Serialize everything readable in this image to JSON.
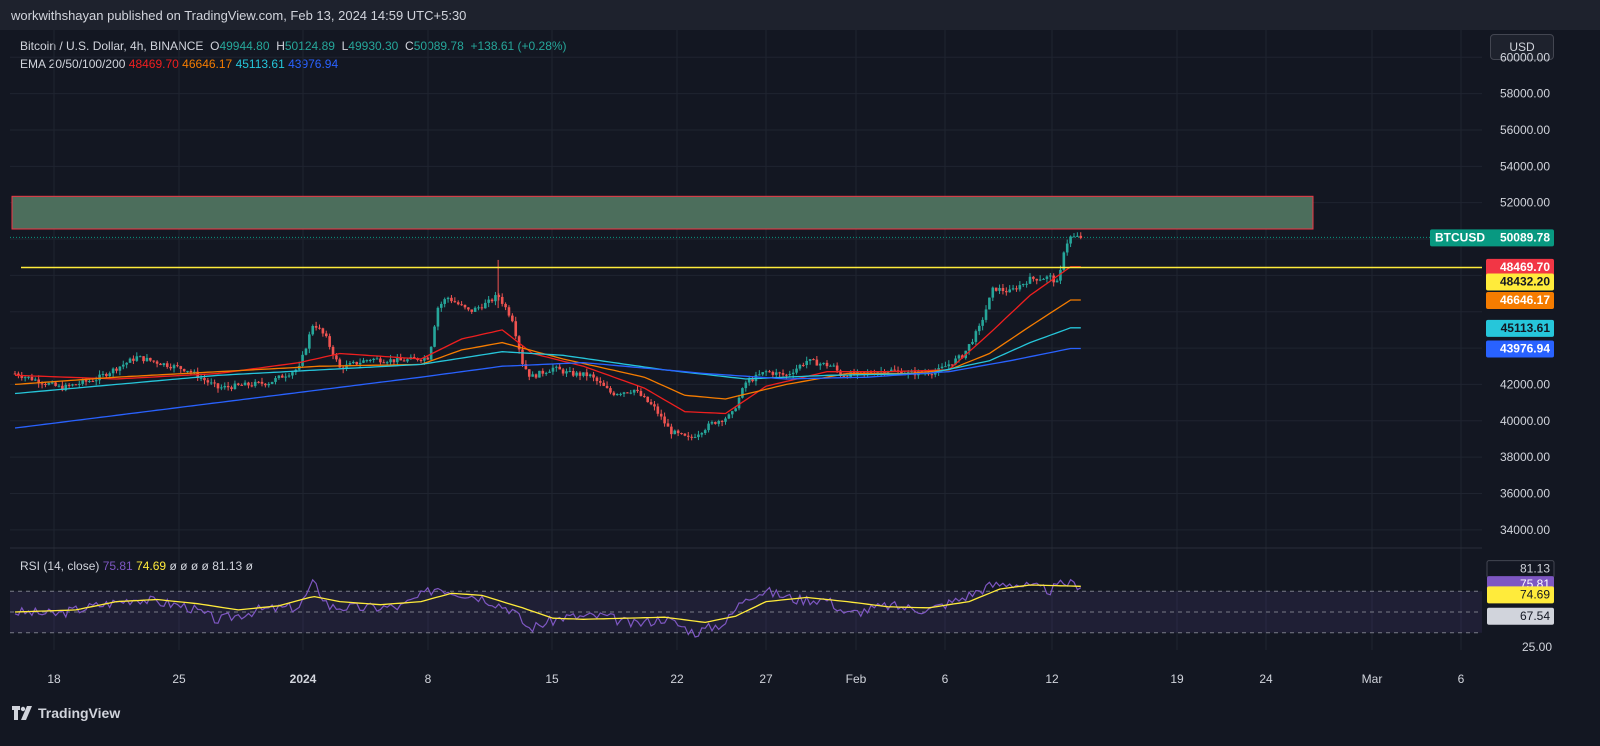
{
  "header": {
    "publisher": "workwithshayan published on TradingView.com, Feb 13, 2024 14:59 UTC+5:30"
  },
  "currency_button": "USD",
  "legend": {
    "symbol": "Bitcoin / U.S. Dollar, 4h, BINANCE",
    "o_label": "O",
    "o_value": "49944.80",
    "h_label": "H",
    "h_value": "50124.89",
    "l_label": "L",
    "l_value": "49930.30",
    "c_label": "C",
    "c_value": "50089.78",
    "change": "+138.61 (+0.28%)",
    "ema_title": "EMA 20/50/100/200",
    "ema20": "48469.70",
    "ema50": "46646.17",
    "ema100": "45113.61",
    "ema200": "43976.94"
  },
  "rsi_legend": {
    "title": "RSI (14, close)",
    "rsi": "75.81",
    "ma": "74.69",
    "empties": [
      "ø",
      "ø",
      "ø",
      "ø"
    ],
    "upper": "81.13",
    "last": "ø"
  },
  "brand": "TradingView",
  "colors": {
    "up": "#26a69a",
    "down": "#ef5350",
    "ema20": "#ef1f1f",
    "ema50": "#f57c00",
    "ema100": "#26c6da",
    "ema200": "#2962ff",
    "level": "#ffeb3b",
    "zone_fill": "#4c6e5c",
    "zone_border": "#f23645",
    "rsi_line": "#7e57c2",
    "rsi_ma": "#ffeb3b"
  },
  "chart_data": {
    "type": "candlestick",
    "title": "Bitcoin / U.S. Dollar, 4h, BINANCE",
    "price_axis": {
      "ticks": [
        "60000.00",
        "58000.00",
        "56000.00",
        "54000.00",
        "52000.00",
        "42000.00",
        "40000.00",
        "38000.00",
        "36000.00",
        "34000.00"
      ],
      "ylim": [
        33000,
        61500
      ]
    },
    "x_axis": {
      "labels": [
        "18",
        "25",
        "2024",
        "8",
        "15",
        "22",
        "27",
        "Feb",
        "6",
        "12",
        "19",
        "24",
        "Mar",
        "6"
      ]
    },
    "series_anchors": {
      "price": [
        [
          0,
          42600
        ],
        [
          2.3,
          41800
        ],
        [
          4,
          42300
        ],
        [
          6,
          43500
        ],
        [
          8.5,
          42800
        ],
        [
          10,
          41800
        ],
        [
          12.5,
          42100
        ],
        [
          14,
          42900
        ],
        [
          14.7,
          45400
        ],
        [
          15.3,
          44600
        ],
        [
          16,
          42900
        ],
        [
          17.5,
          43400
        ],
        [
          19,
          43300
        ],
        [
          20.4,
          43500
        ],
        [
          20.8,
          46200
        ],
        [
          21.3,
          46800
        ],
        [
          22.4,
          46000
        ],
        [
          23.3,
          46500
        ],
        [
          23.8,
          46900
        ],
        [
          24.5,
          45600
        ],
        [
          25,
          43200
        ],
        [
          25.4,
          42400
        ],
        [
          26.5,
          42900
        ],
        [
          27.3,
          42600
        ],
        [
          28.3,
          42500
        ],
        [
          29.4,
          41500
        ],
        [
          30.5,
          41700
        ],
        [
          31.5,
          40700
        ],
        [
          32.3,
          39400
        ],
        [
          33.2,
          39000
        ],
        [
          34.4,
          39900
        ],
        [
          35.3,
          40300
        ],
        [
          36,
          42100
        ],
        [
          37,
          42700
        ],
        [
          38,
          42500
        ],
        [
          39,
          43300
        ],
        [
          40.3,
          43000
        ],
        [
          40.7,
          42500
        ],
        [
          42,
          42600
        ],
        [
          43,
          42800
        ],
        [
          44,
          42600
        ],
        [
          45.4,
          42700
        ],
        [
          46.7,
          43600
        ],
        [
          47.5,
          45100
        ],
        [
          48.2,
          47300
        ],
        [
          49,
          47100
        ],
        [
          50,
          47800
        ],
        [
          51,
          47900
        ],
        [
          51.4,
          47500
        ],
        [
          51.7,
          49600
        ],
        [
          52,
          50100
        ],
        [
          52.5,
          50090
        ]
      ],
      "ema20": [
        [
          0,
          42500
        ],
        [
          5,
          42300
        ],
        [
          10,
          42600
        ],
        [
          14,
          43200
        ],
        [
          16,
          43700
        ],
        [
          20,
          43400
        ],
        [
          22,
          44500
        ],
        [
          24,
          45000
        ],
        [
          25.5,
          43700
        ],
        [
          28,
          43000
        ],
        [
          31,
          41800
        ],
        [
          33,
          40500
        ],
        [
          35,
          40400
        ],
        [
          37,
          41900
        ],
        [
          40,
          42700
        ],
        [
          43,
          42700
        ],
        [
          46,
          42800
        ],
        [
          48,
          44800
        ],
        [
          50,
          46900
        ],
        [
          52,
          48470
        ]
      ],
      "ema50": [
        [
          0,
          42000
        ],
        [
          5,
          42400
        ],
        [
          10,
          42700
        ],
        [
          15,
          43000
        ],
        [
          20,
          43100
        ],
        [
          22,
          43900
        ],
        [
          24,
          44300
        ],
        [
          27,
          43400
        ],
        [
          31,
          42400
        ],
        [
          33,
          41400
        ],
        [
          35,
          41200
        ],
        [
          38,
          42000
        ],
        [
          41,
          42600
        ],
        [
          44,
          42600
        ],
        [
          46,
          42800
        ],
        [
          48,
          43700
        ],
        [
          50,
          45200
        ],
        [
          52,
          46646
        ]
      ],
      "ema100": [
        [
          0,
          41500
        ],
        [
          5,
          42000
        ],
        [
          10,
          42500
        ],
        [
          15,
          42800
        ],
        [
          20,
          43100
        ],
        [
          24,
          43800
        ],
        [
          27,
          43600
        ],
        [
          32,
          42800
        ],
        [
          36,
          42300
        ],
        [
          40,
          42500
        ],
        [
          45,
          42600
        ],
        [
          48,
          43300
        ],
        [
          50,
          44300
        ],
        [
          52,
          45114
        ]
      ],
      "ema200": [
        [
          0,
          39600
        ],
        [
          5,
          40300
        ],
        [
          10,
          41000
        ],
        [
          15,
          41700
        ],
        [
          20,
          42400
        ],
        [
          24,
          43000
        ],
        [
          28,
          43200
        ],
        [
          34,
          42600
        ],
        [
          38,
          42300
        ],
        [
          42,
          42400
        ],
        [
          46,
          42700
        ],
        [
          49,
          43300
        ],
        [
          52,
          43977
        ]
      ],
      "rsi": [
        [
          0,
          50
        ],
        [
          2,
          48
        ],
        [
          4,
          56
        ],
        [
          6,
          63
        ],
        [
          8.5,
          55
        ],
        [
          10,
          42
        ],
        [
          12,
          52
        ],
        [
          14,
          55
        ],
        [
          14.7,
          78
        ],
        [
          15.5,
          55
        ],
        [
          17,
          54
        ],
        [
          19,
          55
        ],
        [
          20.8,
          74
        ],
        [
          21.5,
          70
        ],
        [
          23,
          64
        ],
        [
          24.5,
          52
        ],
        [
          25.3,
          34
        ],
        [
          27,
          45
        ],
        [
          29,
          46
        ],
        [
          30.5,
          38
        ],
        [
          32,
          44
        ],
        [
          33.5,
          30
        ],
        [
          35,
          40
        ],
        [
          36,
          65
        ],
        [
          37,
          70
        ],
        [
          38.5,
          62
        ],
        [
          40,
          62
        ],
        [
          41,
          48
        ],
        [
          43,
          56
        ],
        [
          45,
          52
        ],
        [
          46.5,
          62
        ],
        [
          48,
          75
        ],
        [
          49,
          78
        ],
        [
          50,
          74
        ],
        [
          51,
          71
        ],
        [
          51.7,
          78
        ],
        [
          52.5,
          75.81
        ]
      ],
      "rsi_ma": [
        [
          0,
          50
        ],
        [
          3,
          52
        ],
        [
          5,
          60
        ],
        [
          7,
          62
        ],
        [
          9,
          58
        ],
        [
          11,
          52
        ],
        [
          13,
          56
        ],
        [
          14.7,
          65
        ],
        [
          16,
          60
        ],
        [
          18,
          57
        ],
        [
          20,
          60
        ],
        [
          21.5,
          68
        ],
        [
          23,
          66
        ],
        [
          25,
          54
        ],
        [
          26.5,
          44
        ],
        [
          28,
          43
        ],
        [
          30,
          44
        ],
        [
          32,
          45
        ],
        [
          34,
          40
        ],
        [
          35.5,
          46
        ],
        [
          37,
          60
        ],
        [
          39,
          64
        ],
        [
          41,
          60
        ],
        [
          43,
          55
        ],
        [
          45,
          54
        ],
        [
          47,
          60
        ],
        [
          48.5,
          72
        ],
        [
          50,
          76
        ],
        [
          52.5,
          74.69
        ]
      ]
    },
    "resistance_zone": [
      50550,
      52350
    ],
    "horizontal_level": 48432.2,
    "last_price": 50089.78,
    "price_labels": [
      {
        "text": "BTCUSD",
        "value": "50089.78",
        "price": 50089.78,
        "color": "#089981",
        "fg": "#ffffff"
      },
      {
        "text": "",
        "value": "48469.70",
        "price": 48469.7,
        "color": "#f23645",
        "fg": "#ffffff"
      },
      {
        "text": "",
        "value": "48432.20",
        "price": 48432.2,
        "color": "#ffeb3b",
        "fg": "#131722",
        "nudge": 1
      },
      {
        "text": "",
        "value": "46646.17",
        "price": 46646.17,
        "color": "#f57c00",
        "fg": "#ffffff"
      },
      {
        "text": "",
        "value": "45113.61",
        "price": 45113.61,
        "color": "#26c6da",
        "fg": "#131722"
      },
      {
        "text": "",
        "value": "43976.94",
        "price": 43976.94,
        "color": "#2962ff",
        "fg": "#ffffff"
      }
    ],
    "rsi_axis": {
      "ticks": [
        "25.00"
      ],
      "levels": [
        70,
        50,
        30
      ]
    },
    "rsi_labels": [
      {
        "value": "81.13",
        "rsi": 81.13,
        "color": "#131722",
        "fg": "#d1d4dc",
        "border": "#434651"
      },
      {
        "value": "75.81",
        "rsi": 75.81,
        "color": "#7e57c2",
        "fg": "#ffffff"
      },
      {
        "value": "74.69",
        "rsi": 74.69,
        "color": "#ffeb3b",
        "fg": "#131722"
      },
      {
        "value": "67.54",
        "rsi": 67.54,
        "color": "#d1d4dc",
        "fg": "#131722"
      }
    ]
  }
}
